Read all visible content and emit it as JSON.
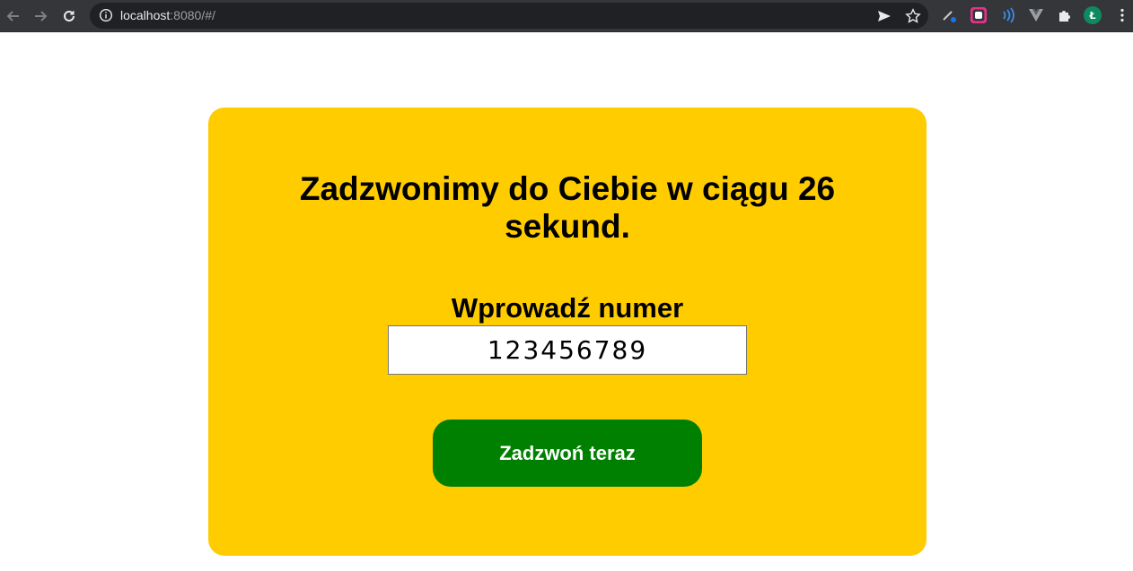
{
  "browser": {
    "url_host": "localhost",
    "url_path": ":8080/#/",
    "profile_initial": "Ł"
  },
  "main": {
    "title": "Zadzwonimy do Ciebie w ciągu 26 sekund.",
    "input_label": "Wprowadź numer",
    "phone_value": "123456789",
    "call_button_label": "Zadzwoń teraz"
  },
  "colors": {
    "card_background": "#ffcc00",
    "button_background": "#008000",
    "button_text": "#ffffff"
  },
  "icons": {
    "back": "arrow-left-icon",
    "forward": "arrow-right-icon",
    "reload": "reload-icon",
    "site_info": "info-icon",
    "send": "send-icon",
    "bookmark": "star-icon",
    "extensions": "puzzle-icon",
    "menu": "more-vert-icon"
  }
}
